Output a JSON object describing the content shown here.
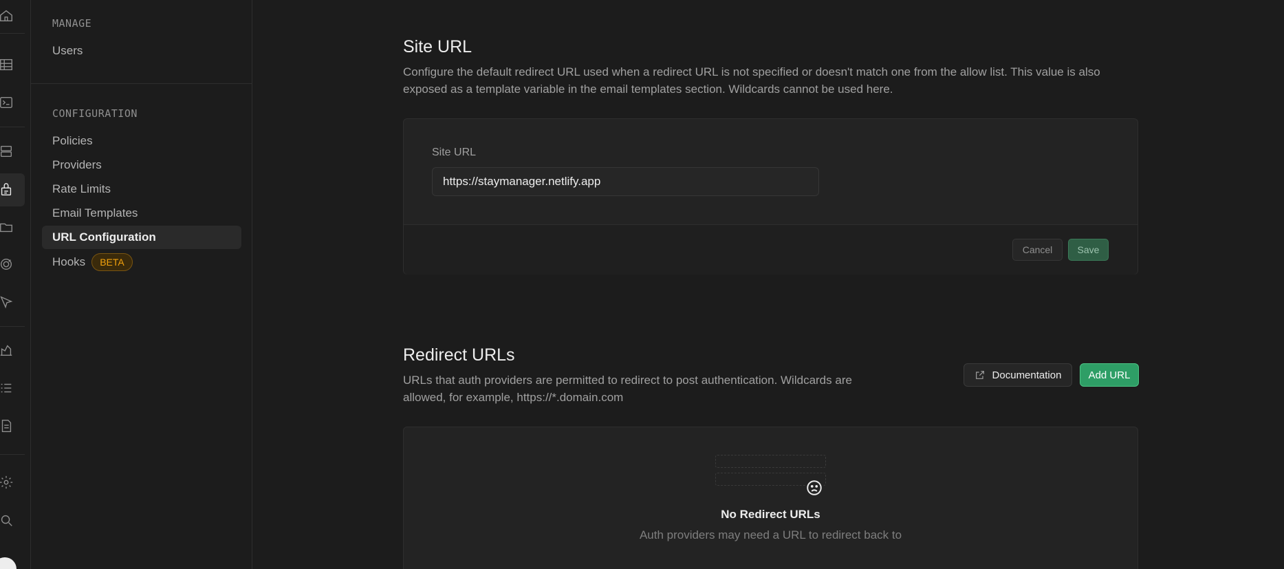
{
  "rail": {
    "icons": [
      "home-icon",
      "table-icon",
      "terminal-icon",
      "database-icon",
      "auth-icon",
      "storage-icon",
      "realtime-icon",
      "edge-functions-icon",
      "reports-icon",
      "logs-icon",
      "docs-icon",
      "settings-icon",
      "search-icon",
      "avatar-icon"
    ]
  },
  "sidebar": {
    "manage_title": "MANAGE",
    "manage_items": [
      {
        "label": "Users"
      }
    ],
    "config_title": "CONFIGURATION",
    "config_items": [
      {
        "label": "Policies"
      },
      {
        "label": "Providers"
      },
      {
        "label": "Rate Limits"
      },
      {
        "label": "Email Templates"
      },
      {
        "label": "URL Configuration",
        "active": true
      },
      {
        "label": "Hooks",
        "badge": "BETA"
      }
    ]
  },
  "site_url": {
    "title": "Site URL",
    "description": "Configure the default redirect URL used when a redirect URL is not specified or doesn't match one from the allow list. This value is also exposed as a template variable in the email templates section. Wildcards cannot be used here.",
    "field_label": "Site URL",
    "field_value": "https://staymanager.netlify.app",
    "cancel_label": "Cancel",
    "save_label": "Save"
  },
  "redirect_urls": {
    "title": "Redirect URLs",
    "description": "URLs that auth providers are permitted to redirect to post authentication. Wildcards are allowed, for example, https://*.domain.com",
    "doc_label": "Documentation",
    "add_label": "Add URL",
    "empty_title": "No Redirect URLs",
    "empty_subtitle": "Auth providers may need a URL to redirect back to"
  },
  "colors": {
    "background": "#1c1c1c",
    "accent_green": "#2e9e66",
    "badge_amber": "#f1a10d"
  }
}
